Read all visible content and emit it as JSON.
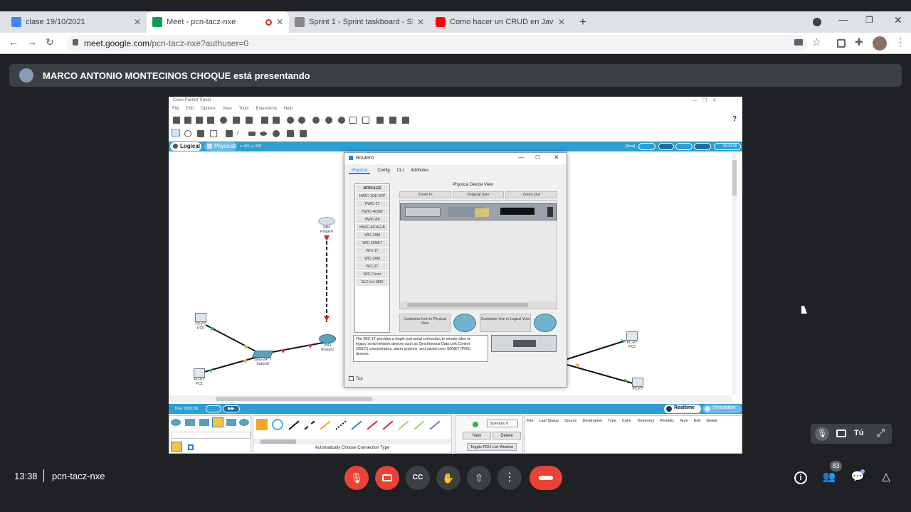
{
  "tabs": [
    {
      "label": "clase 19/10/2021",
      "color": "#4285f4",
      "active": false
    },
    {
      "label": "Meet - pcn-tacz-nxe",
      "color": "#0f9d58",
      "active": true
    },
    {
      "label": "Sprint 1 - Sprint taskboard - SMA",
      "color": "#888888",
      "active": false
    },
    {
      "label": "Como hacer un CRUD en Java Sp",
      "color": "#ff0000",
      "active": false
    }
  ],
  "address": {
    "host": "meet.google.com",
    "path": "/pcn-tacz-nxe?authuser=0"
  },
  "presenter": {
    "text": "MARCO ANTONIO MONTECINOS CHOQUE está presentando"
  },
  "pt": {
    "window_title": "Cisco Packet Tracer",
    "menu": [
      "File",
      "Edit",
      "Options",
      "View",
      "Tools",
      "Extensions",
      "Help"
    ],
    "mode_logical": "Logical",
    "mode_physical": "Physical",
    "coords": "x: 431, y: 200",
    "root_label": "[Root]",
    "time_label": "00:34:30",
    "devices": {
      "router0": {
        "model": "1841",
        "name": "Router0"
      },
      "router2": {
        "model": "1841",
        "name": "Router2"
      },
      "switch0": {
        "model": "2960-24TT",
        "name": "Switch0"
      },
      "pc0": {
        "model": "PC-PT",
        "name": "PC0"
      },
      "pc1": {
        "model": "PC-PT",
        "name": "PC1"
      },
      "pc2": {
        "model": "PC-PT",
        "name": "PC2"
      },
      "pc3": {
        "model": "PC-PT",
        "name": ""
      }
    },
    "dialog": {
      "title": "Router0",
      "tabs": [
        "Physical",
        "Config",
        "CLI",
        "Attributes"
      ],
      "physical_view_label": "Physical Device View",
      "zoom_in": "Zoom In",
      "original_size": "Original Size",
      "zoom_out": "Zoom Out",
      "modules": [
        "MODULES",
        "HWIC-1GE-SFP",
        "HWIC-2T",
        "HWIC-4ESW",
        "HWIC-8A",
        "HWIC-AP-AG-B",
        "WIC-1AM",
        "WIC-1ENET",
        "WIC-1T",
        "WIC-2AM",
        "WIC-2T",
        "WIC-Cover",
        "GLC-LH-SMD"
      ],
      "customize_physical": "Customize Icon in Physical View",
      "customize_logical": "Customize Icon in Logical View",
      "description": "The WIC-1T provides a single port serial connection to remote sites or legacy serial network devices such as Synchronous Data Link Control (SDLC) concentrators, alarm systems, and packet over SONET (POS) devices.",
      "top_checkbox": "Top"
    },
    "time_display": "Time: 00:01:58",
    "realtime": "Realtime",
    "simulation": "Simulation",
    "connection_type": "Automatically Choose Connection Type",
    "scenario": "Scenario 0",
    "new_btn": "New",
    "delete_btn": "Delete",
    "toggle_pdu": "Toggle PDU List Window",
    "pdu_columns": [
      "Fire",
      "Last Status",
      "Source",
      "Destination",
      "Type",
      "Color",
      "Time(sec)",
      "Periodic",
      "Num",
      "Edit",
      "Delete"
    ]
  },
  "self_view": {
    "label": "Tú"
  },
  "bottom": {
    "time": "13:38",
    "meeting_code": "pcn-tacz-nxe",
    "participants_count": "83"
  }
}
